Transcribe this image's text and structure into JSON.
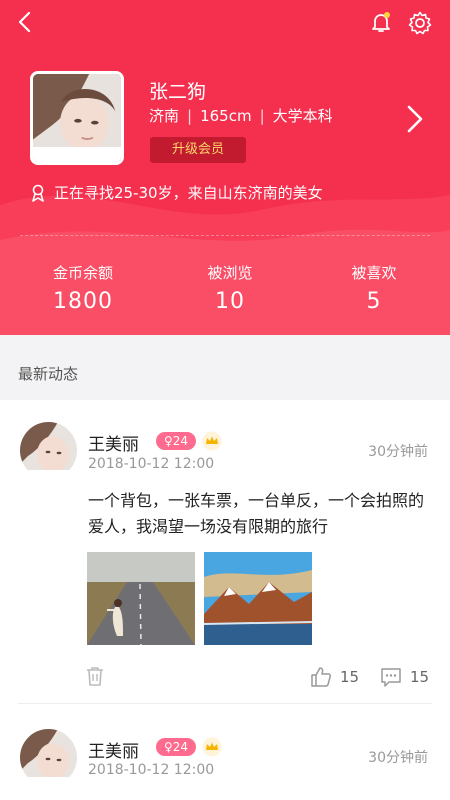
{
  "profile": {
    "name": "张二狗",
    "city": "济南",
    "height": "165cm",
    "education": "大学本科",
    "upgrade_label": "升级会员",
    "seeking": "正在寻找25-30岁，来自山东济南的美女"
  },
  "stats": [
    {
      "label": "金币余额",
      "value": "1800"
    },
    {
      "label": "被浏览",
      "value": "10"
    },
    {
      "label": "被喜欢",
      "value": "5"
    }
  ],
  "section": {
    "title": "最新动态"
  },
  "posts": [
    {
      "name": "王美丽",
      "age": "♀24",
      "date": "2018-10-12 12:00",
      "time_ago": "30分钟前",
      "text": "一个背包，一张车票，一台单反，一个会拍照的爱人，我渴望一场没有限期的旅行",
      "likes": "15",
      "comments": "15"
    },
    {
      "name": "王美丽",
      "age": "♀24",
      "date": "2018-10-12 12:00",
      "time_ago": "30分钟前"
    }
  ],
  "icons": {
    "back": "back-arrow-icon",
    "bell": "bell-icon",
    "settings": "gear-icon",
    "chevron": "chevron-right-icon",
    "seek": "ribbon-icon",
    "crown": "crown-icon",
    "trash": "trash-icon",
    "like": "thumbs-up-icon",
    "comment": "comment-icon"
  },
  "colors": {
    "brand": "#f5304f",
    "upgrade_bg": "#c21a2f",
    "upgrade_text": "#ffd66b",
    "age_badge": "#ff6b8e"
  }
}
